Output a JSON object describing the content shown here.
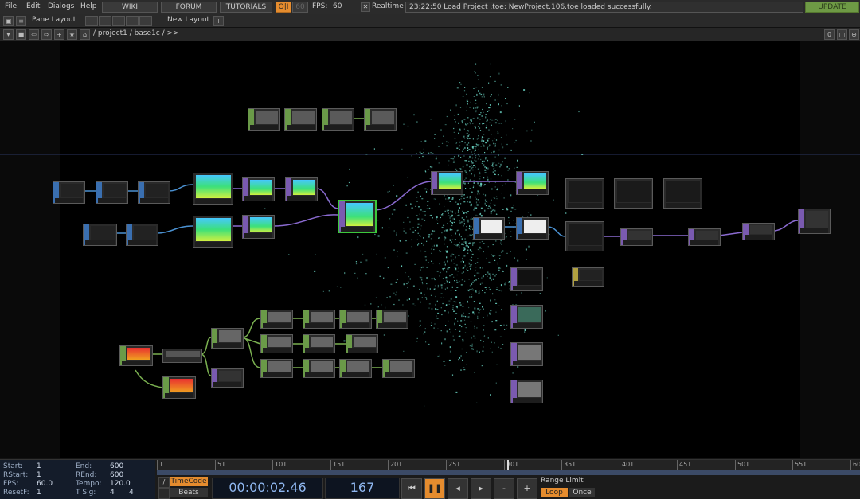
{
  "menu": {
    "items": [
      "File",
      "Edit",
      "Dialogs",
      "Help"
    ],
    "buttons": {
      "wiki": "WIKI",
      "forum": "FORUM",
      "tutorials": "TUTORIALS"
    },
    "fps_label": "FPS:",
    "fps_value": "60",
    "fps_cap": "60",
    "realtime_label": "Realtime",
    "status_message": "23:22:50 Load Project .toe: NewProject.106.toe loaded successfully.",
    "update_label": "UPDATE"
  },
  "toolbar": {
    "pane_layout": "Pane Layout",
    "new_layout": "New Layout",
    "plus": "+"
  },
  "pathbar": {
    "path": "/ project1 / base1c / >>",
    "page_num": "0"
  },
  "stats": {
    "start_label": "Start:",
    "start_value": "1",
    "rstart_label": "RStart:",
    "rstart_value": "1",
    "fps_label": "FPS:",
    "fps_value": "60.0",
    "resetf_label": "ResetF:",
    "resetf_value": "1",
    "end_label": "End:",
    "end_value": "600",
    "rend_label": "REnd:",
    "rend_value": "600",
    "tempo_label": "Tempo:",
    "tempo_value": "120.0",
    "tsig_label": "T Sig:",
    "tsig_a": "4",
    "tsig_b": "4"
  },
  "timeline": {
    "ticks": [
      "1",
      "51",
      "101",
      "151",
      "201",
      "251",
      "301",
      "351",
      "401",
      "451",
      "501",
      "551",
      "600"
    ],
    "timecode_label": "TimeCode",
    "beats_label": "Beats",
    "timecode": "00:00:02.46",
    "frame": "167",
    "range_limit": "Range Limit",
    "loop": "Loop",
    "once": "Once"
  },
  "colors": {
    "accent_orange": "#e58c2e",
    "top_green": "#6e9a45",
    "particles": "#6cd6c6",
    "node_blue": "#3a6fb0",
    "node_purple": "#7a5ab0",
    "node_green": "#6a9a48"
  },
  "icons": {
    "realtime_checkbox": "checkbox-icon",
    "play_pause": "pause-icon",
    "rewind": "rewind-icon",
    "step_back": "step-back-icon",
    "step_forward": "step-forward-icon",
    "minus": "minus-icon",
    "plus": "plus-icon"
  }
}
